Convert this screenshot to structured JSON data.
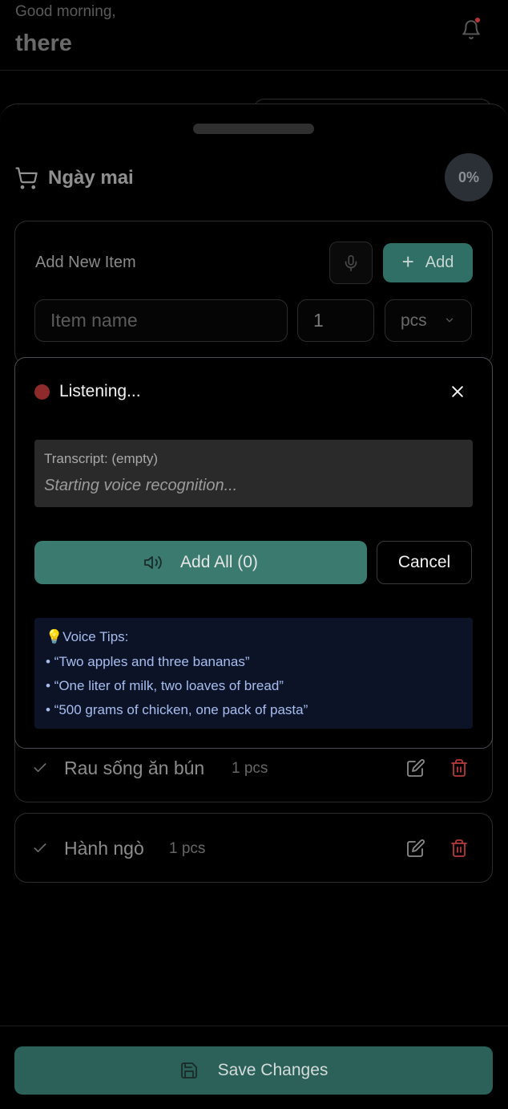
{
  "header": {
    "greeting": "Good morning,",
    "username": "there"
  },
  "list": {
    "title": "Ngày mai",
    "progress": "0%"
  },
  "add_item": {
    "label": "Add New Item",
    "add_button": "Add",
    "name_placeholder": "Item name",
    "quantity_value": "1",
    "unit_value": "pcs"
  },
  "voice": {
    "status": "Listening...",
    "transcript_label": "Transcript: (empty)",
    "transcript_text": "Starting voice recognition...",
    "add_all_button": "Add All (0)",
    "cancel_button": "Cancel",
    "tips_title": "💡Voice Tips:",
    "tips": [
      "• “Two apples and three bananas”",
      "• “One liter of milk, two loaves of bread”",
      "• “500 grams of chicken, one pack of pasta”"
    ]
  },
  "items": [
    {
      "name": "Rau sống ăn bún",
      "quantity": "1 pcs"
    },
    {
      "name": "Hành ngò",
      "quantity": "1 pcs"
    }
  ],
  "footer": {
    "save_button": "Save Changes"
  },
  "colors": {
    "accent": "#3a7a6f",
    "danger": "#b8383a",
    "recording": "#8e2a2a",
    "tips_background": "#0d1326",
    "tips_text": "#a7bdf0"
  }
}
